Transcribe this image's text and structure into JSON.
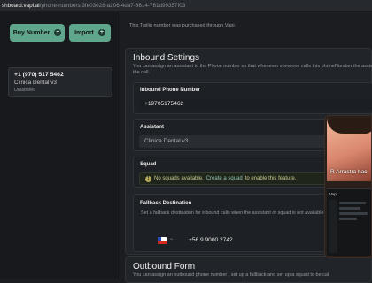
{
  "browser": {
    "url_host": "shboard.vapi.ai",
    "url_path": "/phone-numbers/3fe03028-a206-4da7-8614-761d99357f03"
  },
  "sidebar": {
    "buy_label": "Buy Number",
    "import_label": "Import",
    "phone_items": [
      {
        "number": "+1 (970) 517 5462",
        "name": "Clinica Dental v3",
        "tag": "Unlabeled"
      }
    ]
  },
  "main": {
    "note": "This Twilio number was purchased through Vapi.",
    "inbound": {
      "title": "Inbound Settings",
      "description_line1": "You can assign an assistant to the Phone number so that whenever someone calls this phoneNumber the assistant",
      "description_line2": "the call.",
      "phone_label": "Inbound Phone Number",
      "phone_value": "+19705175462",
      "assistant_label": "Assistant",
      "assistant_value": "Clinica Dental v3",
      "squad_label": "Squad",
      "squad_msg_before": "No squads available.",
      "squad_link": "Create a squad",
      "squad_msg_after": "to enable this feature.",
      "fallback_label": "Fallback Destination",
      "fallback_desc": "Set a fallback destination for inbound calls when the assistant or squad is not available.",
      "fallback_value": "+56 9 9000 2742"
    },
    "outbound": {
      "title": "Outbound Form",
      "description": "You can assign an outbound phone number , set up a fallback and set up a squad to be cal"
    }
  },
  "overlay": {
    "caption": "R Arrastra hac",
    "mini_title": "Vapi"
  },
  "colors": {
    "accent": "#5fa68c",
    "background": "#1b1d20",
    "panel": "#212428"
  }
}
